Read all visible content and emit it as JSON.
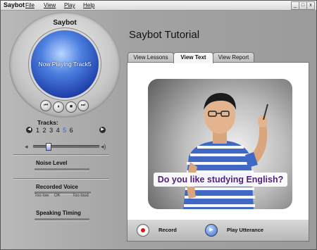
{
  "app": {
    "title": "Saybot"
  },
  "menu": [
    {
      "label": "File"
    },
    {
      "label": "View"
    },
    {
      "label": "Play"
    },
    {
      "label": "Help"
    }
  ],
  "window_controls": {
    "minimize": "_",
    "maximize": "□",
    "close": "x"
  },
  "player": {
    "title": "Saybot",
    "display_text": "Now Playing Track5",
    "controls": {
      "prev": "previous-icon",
      "pause": "pause-icon",
      "stop": "stop-icon",
      "next": "next-icon"
    }
  },
  "tracks": {
    "label": "Tracks:",
    "numbers": [
      "1",
      "2",
      "3",
      "4",
      "5",
      "6"
    ],
    "current_index": 4
  },
  "volume": {
    "level": 0.22
  },
  "noise": {
    "label": "Noise Level"
  },
  "recorded_voice": {
    "label": "Recorded Voice",
    "low": "Too low",
    "ok": "OK",
    "loud": "Too loud"
  },
  "timing": {
    "label": "Speaking Timing"
  },
  "tutorial": {
    "title": "Saybot Tutorial",
    "tabs": [
      {
        "label": "View Lessons"
      },
      {
        "label": "View Text",
        "active": true
      },
      {
        "label": "View Report"
      }
    ],
    "caption": "Do you like studying English?"
  },
  "actions": {
    "record_label": "Record",
    "play_label": "Play Utterance"
  },
  "colors": {
    "accent": "#3c5ec8",
    "record": "#d31616",
    "caption_text": "#4b1f7a"
  }
}
